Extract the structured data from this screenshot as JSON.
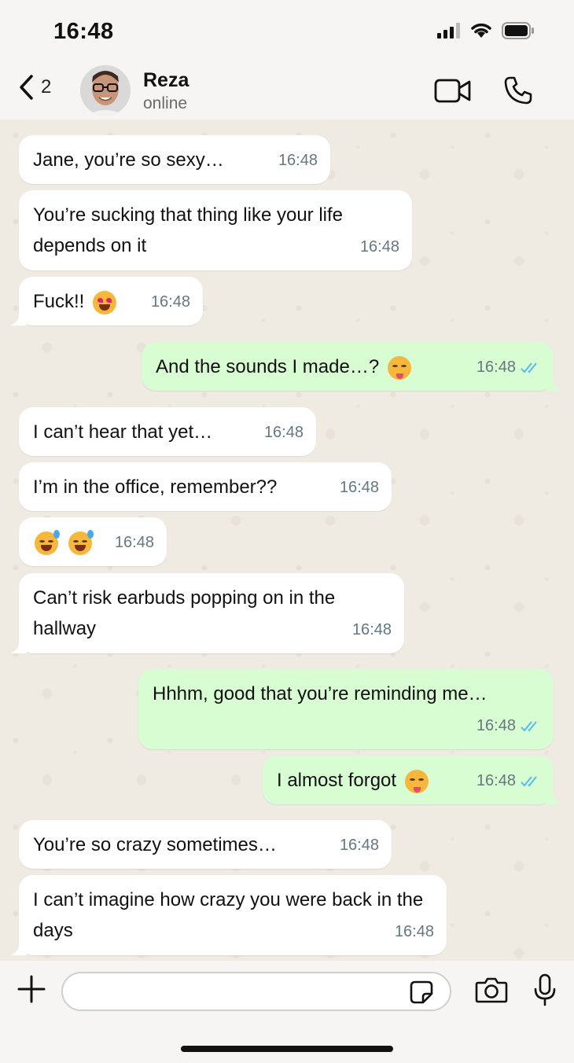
{
  "status_bar": {
    "time": "16:48"
  },
  "header": {
    "back_count": "2",
    "contact_name": "Reza",
    "contact_status": "online"
  },
  "messages": [
    {
      "dir": "in",
      "text": "Jane, you’re so sexy…",
      "time": "16:48"
    },
    {
      "dir": "in",
      "text": "You’re sucking that thing like your life depends on it",
      "time": "16:48"
    },
    {
      "dir": "in",
      "text": "Fuck!!",
      "emoji": "star-struck-emoji",
      "time": "16:48"
    },
    {
      "dir": "out",
      "text": "And the sounds I made…?",
      "emoji": "tongue-emoji",
      "time": "16:48",
      "read": true
    },
    {
      "dir": "in",
      "text": "I can’t hear that yet…",
      "time": "16:48"
    },
    {
      "dir": "in",
      "text": "I’m in the office, remember??",
      "time": "16:48"
    },
    {
      "dir": "in",
      "text": "",
      "emoji": "sweat-smile-emoji",
      "time": "16:48"
    },
    {
      "dir": "in",
      "text": "Can’t risk earbuds popping on in the hallway",
      "time": "16:48"
    },
    {
      "dir": "out",
      "text": "Hhhm, good that you’re reminding me…",
      "time": "16:48",
      "read": true
    },
    {
      "dir": "out",
      "text": "I almost forgot",
      "emoji": "yum-emoji",
      "time": "16:48",
      "read": true
    },
    {
      "dir": "in",
      "text": "You’re so crazy sometimes…",
      "time": "16:48"
    },
    {
      "dir": "in",
      "text": "I can’t imagine how crazy you were back in the days",
      "time": "16:48"
    }
  ],
  "input": {
    "placeholder": ""
  },
  "colors": {
    "incoming_bubble": "#ffffff",
    "outgoing_bubble": "#d9fdd3",
    "read_ticks": "#53bdeb",
    "chat_background": "#efeae2"
  }
}
